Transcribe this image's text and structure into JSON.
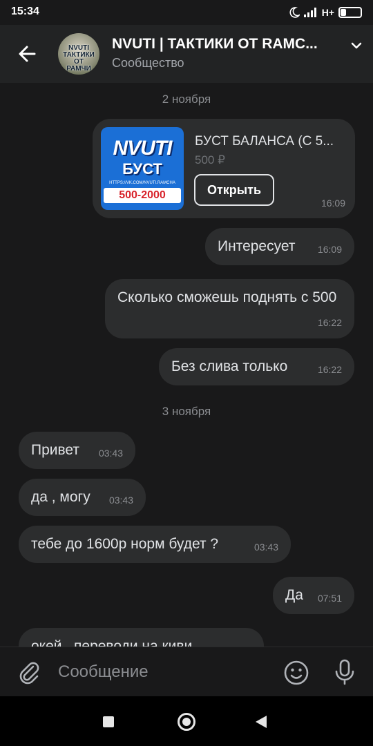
{
  "status_bar": {
    "time": "15:34",
    "network": "H+",
    "battery": "28",
    "battery_level": 0.28
  },
  "header": {
    "title": "NVUTI | ТАКТИКИ ОТ  RAMC...",
    "subtitle": "Сообщество",
    "avatar_text": "NVUTI ТАКТИКИ ОТ РАМЧИ"
  },
  "chat": {
    "date_1": "2 ноября",
    "product": {
      "title": "БУСТ БАЛАНСА (С 5...",
      "price": "500 ₽",
      "button": "Открыть",
      "time": "16:09",
      "image_text": {
        "brand": "NVUTI",
        "label": "БУСТ",
        "url": "HTTPS://VK.COM/NVUTI.RAMCHA",
        "range": "500-2000"
      }
    },
    "messages_1": [
      {
        "text": "Интересует",
        "time": "16:09",
        "side": "out"
      },
      {
        "text": "Сколько сможешь поднять с 500",
        "time": "16:22",
        "side": "out"
      },
      {
        "text": "Без слива только",
        "time": "16:22",
        "side": "out"
      }
    ],
    "date_2": "3 ноября",
    "messages_2": [
      {
        "text": "Привет",
        "time": "03:43",
        "side": "in"
      },
      {
        "text": "да , могу",
        "time": "03:43",
        "side": "in"
      },
      {
        "text": "тебе до 1600р норм будет ?",
        "time": "03:43",
        "side": "in"
      },
      {
        "text": "Да",
        "time": "07:51",
        "side": "out"
      },
      {
        "text": "окей , переводи на киви",
        "time": "",
        "side": "in"
      }
    ]
  },
  "composer": {
    "placeholder": "Сообщение"
  },
  "colors": {
    "background": "#19191a",
    "header": "#222324",
    "bubble": "#2c2d2e",
    "muted": "#8b8d91"
  }
}
